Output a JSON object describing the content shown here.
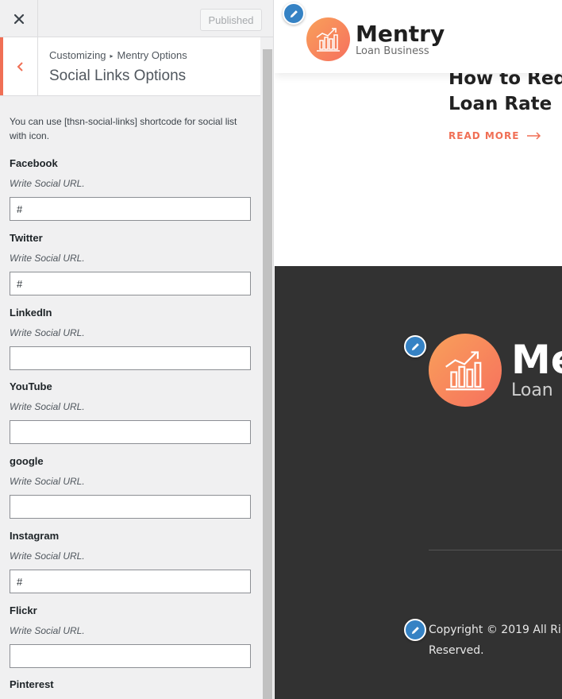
{
  "topbar": {
    "close_icon": "close-icon",
    "publish_label": "Published"
  },
  "section": {
    "breadcrumb_root": "Customizing",
    "breadcrumb_parent": "Mentry Options",
    "title": "Social Links Options",
    "description": "You can use [thsn-social-links] shortcode for social list with icon."
  },
  "fields": [
    {
      "label": "Facebook",
      "hint": "Write Social URL.",
      "value": "#"
    },
    {
      "label": "Twitter",
      "hint": "Write Social URL.",
      "value": "#"
    },
    {
      "label": "LinkedIn",
      "hint": "Write Social URL.",
      "value": ""
    },
    {
      "label": "YouTube",
      "hint": "Write Social URL.",
      "value": ""
    },
    {
      "label": "google",
      "hint": "Write Social URL.",
      "value": ""
    },
    {
      "label": "Instagram",
      "hint": "Write Social URL.",
      "value": "#"
    },
    {
      "label": "Flickr",
      "hint": "Write Social URL.",
      "value": ""
    },
    {
      "label": "Pinterest",
      "hint": "",
      "value": ""
    }
  ],
  "preview": {
    "logo_name": "Mentry",
    "logo_sub": "Loan Business",
    "footer_logo_name": "Me",
    "footer_logo_sub": "Loan",
    "post_title": "How to Red Loan Rate",
    "read_more": "READ MORE",
    "copyright": "Copyright © 2019 All Ri Reserved."
  },
  "colors": {
    "accent": "#f06f55",
    "edit_shortcut": "#3582c4",
    "footer_bg": "#323232"
  }
}
